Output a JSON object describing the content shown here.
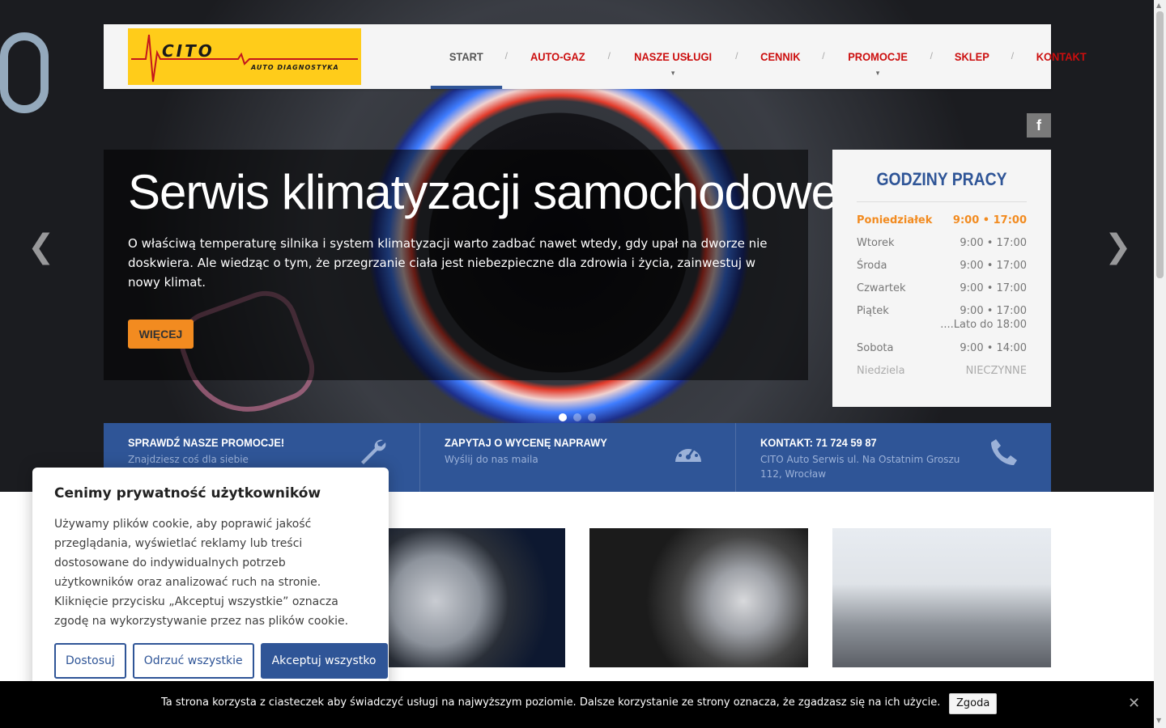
{
  "logo": {
    "brand": "CITO",
    "subtitle": "AUTO DIAGNOSTYKA"
  },
  "nav": {
    "items": [
      {
        "label": "START"
      },
      {
        "label": "AUTO-GAZ"
      },
      {
        "label": "NASZE USŁUGI"
      },
      {
        "label": "CENNIK"
      },
      {
        "label": "PROMOCJE"
      },
      {
        "label": "SKLEP"
      },
      {
        "label": "KONTAKT"
      }
    ],
    "separator": "/",
    "dropdown_caret": "▼"
  },
  "social": {
    "facebook_label": "f"
  },
  "slider": {
    "title": "Serwis klimatyzacji samochodowej",
    "text": "O właściwą temperaturę silnika i system klimatyzacji warto zadbać nawet wtedy, gdy upał na dworze nie doskwiera. Ale wiedząc o tym, że przegrzanie ciała jest niebezpieczne dla zdrowia i życia, zainwestuj w nowy klimat.",
    "button": "WIĘCEJ",
    "prev_arrow": "❮",
    "next_arrow": "❯",
    "slide_count": 3,
    "active_slide": 1
  },
  "hours": {
    "title": "GODZINY PRACY",
    "rows": [
      {
        "day": "Poniedziałek",
        "time": "9:00 • 17:00"
      },
      {
        "day": "Wtorek",
        "time": "9:00 • 17:00"
      },
      {
        "day": "Środa",
        "time": "9:00 • 17:00"
      },
      {
        "day": "Czwartek",
        "time": "9:00 • 17:00"
      },
      {
        "day": "Piątek",
        "time": "9:00 • 17:00"
      },
      {
        "day": "Sobota",
        "time": "9:00 • 14:00"
      },
      {
        "day": "Niedziela",
        "time": "NIECZYNNE"
      }
    ],
    "friday_note": "....Lato do 18:00"
  },
  "infobar": [
    {
      "title": "SPRAWDŹ NASZE PROMOCJE!",
      "subtitle": "Znajdziesz coś dla siebie",
      "icon": "wrench-icon"
    },
    {
      "title": "ZAPYTAJ O WYCENĘ NAPRAWY",
      "subtitle": "Wyślij do nas maila",
      "icon": "gauge-icon"
    },
    {
      "title": "KONTAKT: 71 724 59 87",
      "subtitle": "CITO Auto Serwis ul. Na Ostatnim Groszu 112, Wrocław",
      "icon": "phone-icon"
    }
  ],
  "cards": [
    {
      "image": "brake-disc-photo"
    },
    {
      "image": "wheel-service-photo"
    },
    {
      "image": "ac-service-photo"
    }
  ],
  "cookie_modal": {
    "title": "Cenimy prywatność użytkowników",
    "text": "Używamy plików cookie, aby poprawić jakość przeglądania, wyświetlać reklamy lub treści dostosowane do indywidualnych potrzeb użytkowników oraz analizować ruch na stronie. Kliknięcie przycisku „Akceptuj wszystkie” oznacza zgodę na wykorzystywanie przez nas plików cookie.",
    "customize": "Dostosuj",
    "reject": "Odrzuć wszystkie",
    "accept": "Akceptuj wszystko"
  },
  "cookie_bar": {
    "text": "Ta strona korzysta z ciasteczek aby świadczyć usługi na najwyższym poziomie. Dalsze korzystanie ze strony oznacza, że zgadzasz się na ich użycie.",
    "agree": "Zgoda",
    "close": "✕"
  },
  "colors": {
    "brand_blue": "#2f5597",
    "nav_red": "#cc0e0e",
    "accent_orange": "#f28b20",
    "logo_yellow": "#ffcc1a"
  }
}
